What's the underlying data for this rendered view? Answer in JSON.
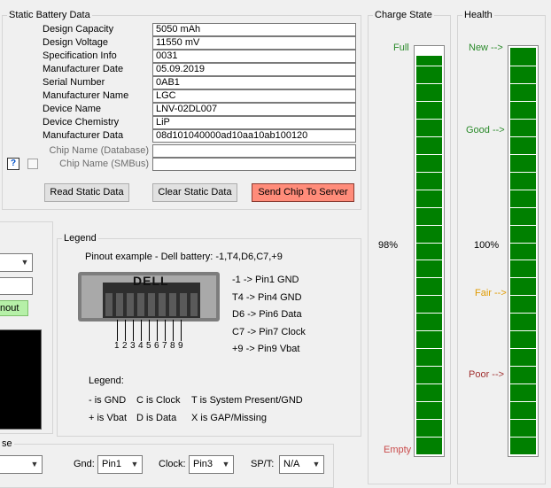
{
  "static": {
    "title": "Static Battery Data",
    "rows": [
      {
        "label": "Design Capacity",
        "value": "5050 mAh"
      },
      {
        "label": "Design Voltage",
        "value": "11550 mV"
      },
      {
        "label": "Specification Info",
        "value": "0031"
      },
      {
        "label": "Manufacturer Date",
        "value": "05.09.2019"
      },
      {
        "label": "Serial Number",
        "value": "0AB1"
      },
      {
        "label": "Manufacturer Name",
        "value": "LGC"
      },
      {
        "label": "Device Name",
        "value": "LNV-02DL007"
      },
      {
        "label": "Device Chemistry",
        "value": "LiP"
      },
      {
        "label": "Manufacturer Data",
        "value": "08d101040000ad10aa10ab100120"
      }
    ],
    "chip_db_label": "Chip Name (Database)",
    "chip_db_value": "",
    "chip_smbus_label": "Chip Name (SMBus)",
    "chip_smbus_value": "",
    "help_label": "?",
    "read_label": "Read Static Data",
    "clear_label": "Clear Static Data",
    "send_label": "Send Chip To Server",
    "send_color": "#ff8c7a"
  },
  "left_partial": {
    "badge": "nout",
    "badge_color": "#b6f0a8",
    "bottom_group_title": "se"
  },
  "legend": {
    "title": "Legend",
    "example": "Pinout example - Dell battery:  -1,T4,D6,C7,+9",
    "connector_brand": "DELL",
    "pin_numbers": [
      "1",
      "2",
      "3",
      "4",
      "5",
      "6",
      "7",
      "8",
      "9"
    ],
    "mappings": [
      "-1 -> Pin1 GND",
      "T4 -> Pin4 GND",
      "D6 -> Pin6 Data",
      "C7 -> Pin7 Clock",
      "+9 -> Pin9 Vbat"
    ],
    "legend_heading": "Legend:",
    "row1": [
      "- is GND",
      "C is Clock",
      "T is System Present/GND"
    ],
    "row2": [
      "+ is Vbat",
      "D is Data",
      "X is GAP/Missing"
    ]
  },
  "pins": {
    "gnd_label": "Gnd:",
    "gnd_value": "Pin1",
    "clock_label": "Clock:",
    "clock_value": "Pin3",
    "spt_label": "SP/T:",
    "spt_value": "N/A"
  },
  "charge": {
    "title": "Charge State",
    "full": "Full",
    "empty": "Empty",
    "percent": "98%",
    "level": 0.98,
    "full_color": "#2a8a2a",
    "empty_color": "#c94a4a"
  },
  "health": {
    "title": "Health",
    "new": "New -->",
    "good": "Good -->",
    "fair": "Fair -->",
    "poor": "Poor -->",
    "percent": "100%",
    "level": 1.0,
    "new_color": "#2a8a2a",
    "good_color": "#2a8a2a",
    "fair_color": "#e09a00",
    "poor_color": "#a03030"
  },
  "bar_color": "#008000"
}
